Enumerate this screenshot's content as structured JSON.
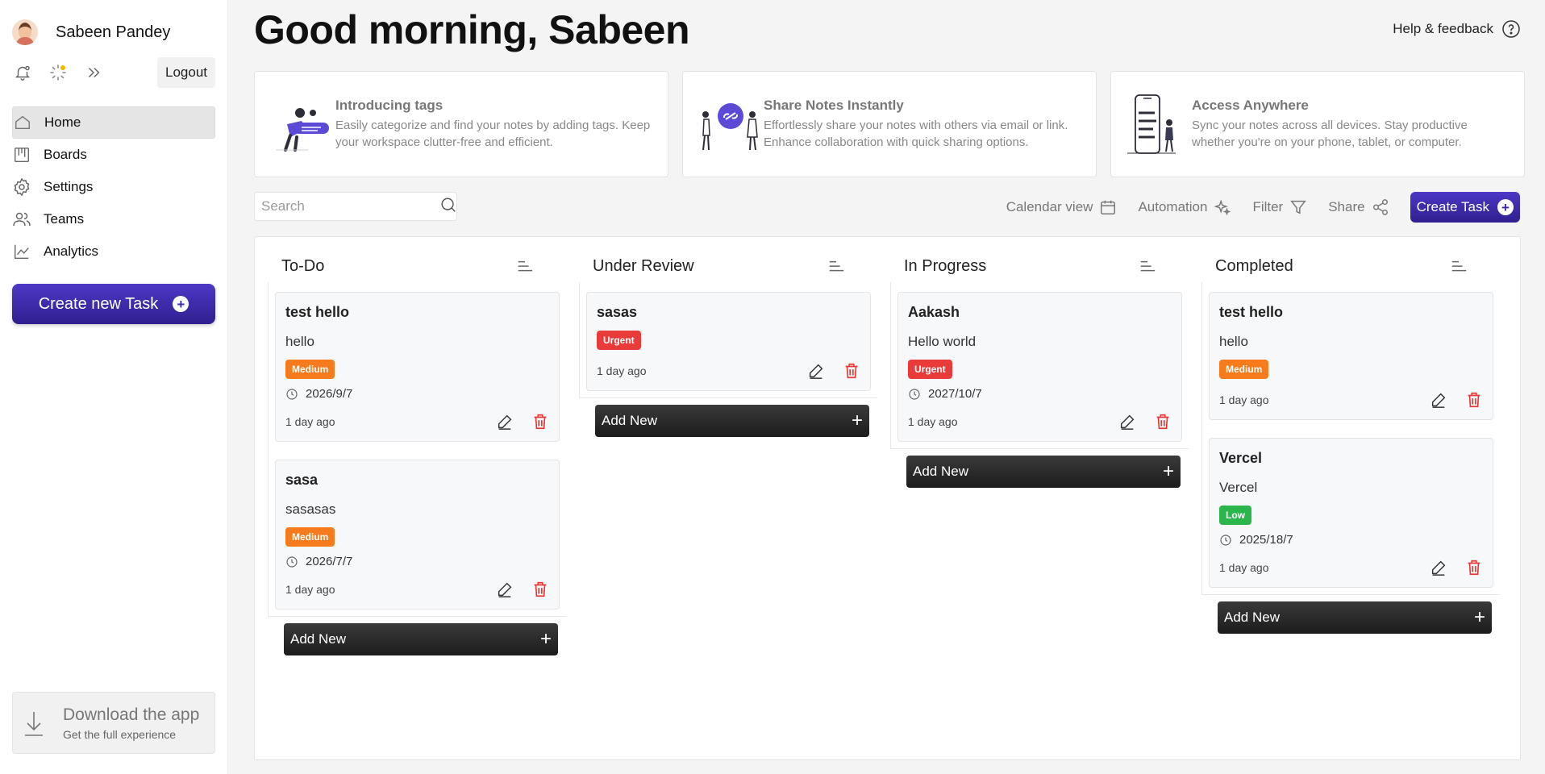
{
  "user": {
    "name": "Sabeen Pandey"
  },
  "sidebar": {
    "logout_label": "Logout",
    "nav": [
      {
        "label": "Home",
        "icon": "home-icon",
        "active": true
      },
      {
        "label": "Boards",
        "icon": "boards-icon"
      },
      {
        "label": "Settings",
        "icon": "settings-icon"
      },
      {
        "label": "Teams",
        "icon": "teams-icon"
      },
      {
        "label": "Analytics",
        "icon": "analytics-icon"
      }
    ],
    "create_label": "Create new Task",
    "download": {
      "title": "Download the app",
      "subtitle": "Get the full experience"
    }
  },
  "header": {
    "greeting": "Good morning, Sabeen",
    "help_label": "Help & feedback"
  },
  "info_cards": [
    {
      "title": "Introducing tags",
      "desc": "Easily categorize and find your notes by adding tags. Keep your workspace clutter-free and efficient."
    },
    {
      "title": "Share Notes Instantly",
      "desc": "Effortlessly share your notes with others via email or link. Enhance collaboration with quick sharing options."
    },
    {
      "title": "Access Anywhere",
      "desc": "Sync your notes across all devices. Stay productive whether you're on your phone, tablet, or computer."
    }
  ],
  "toolbar": {
    "search_placeholder": "Search",
    "calendar_label": "Calendar view",
    "automation_label": "Automation",
    "filter_label": "Filter",
    "share_label": "Share",
    "create_task_label": "Create Task"
  },
  "colors": {
    "accent": "#3a2aa6",
    "medium": "#f57b1c",
    "urgent": "#ea3b3b",
    "low": "#2ab64b"
  },
  "columns": [
    {
      "title": "To-Do",
      "add_label": "Add New",
      "tasks": [
        {
          "name": "test hello",
          "desc": "hello",
          "priority": "Medium",
          "date": "2026/9/7",
          "ago": "1 day ago"
        },
        {
          "name": "sasa",
          "desc": "sasasas",
          "priority": "Medium",
          "date": "2026/7/7",
          "ago": "1 day ago"
        }
      ]
    },
    {
      "title": "Under Review",
      "add_label": "Add New",
      "tasks": [
        {
          "name": "sasas",
          "priority": "Urgent",
          "ago": "1 day ago"
        }
      ]
    },
    {
      "title": "In Progress",
      "add_label": "Add New",
      "tasks": [
        {
          "name": "Aakash",
          "desc": "Hello world",
          "priority": "Urgent",
          "date": "2027/10/7",
          "ago": "1 day ago"
        }
      ]
    },
    {
      "title": "Completed",
      "add_label": "Add New",
      "tasks": [
        {
          "name": "test hello",
          "desc": "hello",
          "priority": "Medium",
          "ago": "1 day ago"
        },
        {
          "name": "Vercel",
          "desc": "Vercel",
          "priority": "Low",
          "date": "2025/18/7",
          "ago": "1 day ago"
        }
      ]
    }
  ]
}
